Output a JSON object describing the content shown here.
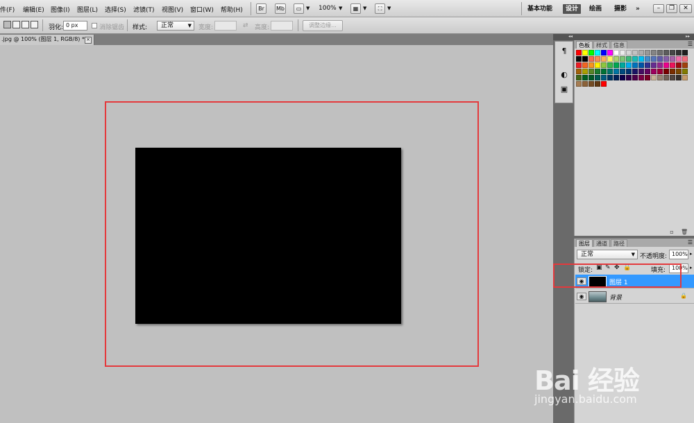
{
  "menu": [
    "件(F)",
    "编辑(E)",
    "图像(I)",
    "图层(L)",
    "选择(S)",
    "滤镜(T)",
    "视图(V)",
    "窗口(W)",
    "帮助(H)"
  ],
  "apptoolbar": {
    "br_label": "Br",
    "mb_label": "Mb",
    "zoom": "100%"
  },
  "workspaces": [
    "基本功能",
    "设计",
    "绘画",
    "摄影",
    "»"
  ],
  "window_buttons": {
    "minimize": "–",
    "restore": "❐",
    "close": "✕"
  },
  "options": {
    "feather_label": "羽化:",
    "feather_value": "0 px",
    "antialias_label": "消除锯齿",
    "style_label": "样式:",
    "style_value": "正常",
    "width_label": "宽度:",
    "height_label": "高度:",
    "refine_edge": "调整边缘..."
  },
  "document": {
    "tab_title": ".jpg @ 100% (图层 1, RGB/8) *",
    "canvas_color": "#000000"
  },
  "swatches_panel": {
    "tabs": [
      "色板",
      "样式",
      "信息"
    ],
    "colors": [
      "#ff0000",
      "#ffff00",
      "#00ff00",
      "#00ffff",
      "#0000ff",
      "#ff00ff",
      "#ffffff",
      "#ebebeb",
      "#d6d6d6",
      "#c2c2c2",
      "#adadad",
      "#999999",
      "#858585",
      "#707070",
      "#5c5c5c",
      "#474747",
      "#333333",
      "#1f1f1f",
      "#0a0a0a",
      "#000000",
      "#f26c4f",
      "#f68e55",
      "#fbaf5c",
      "#fff467",
      "#acd372",
      "#7cc576",
      "#3bb878",
      "#1abbb4",
      "#00bff3",
      "#438ccb",
      "#5574b9",
      "#605ca8",
      "#855fa8",
      "#a763a8",
      "#f06ea9",
      "#f26d7d",
      "#ed1c24",
      "#f26522",
      "#f7941d",
      "#fff200",
      "#8dc73f",
      "#39b54a",
      "#00a651",
      "#00a99d",
      "#00aeef",
      "#0072bc",
      "#0054a6",
      "#2e3192",
      "#662d91",
      "#92278f",
      "#ec008c",
      "#ed145b",
      "#9e0b0f",
      "#a0410d",
      "#a36209",
      "#aba000",
      "#598527",
      "#1a7b30",
      "#007236",
      "#00746b",
      "#0076a3",
      "#004b80",
      "#003471",
      "#1b1464",
      "#440e62",
      "#630460",
      "#9e005d",
      "#9e0039",
      "#790000",
      "#7b2e00",
      "#7d4900",
      "#827b00",
      "#406618",
      "#005e20",
      "#005826",
      "#005952",
      "#005b7f",
      "#003663",
      "#002157",
      "#0d004c",
      "#32004b",
      "#4b0049",
      "#7b0046",
      "#7a0026",
      "#c7b299",
      "#998675",
      "#736357",
      "#534741",
      "#37302d",
      "#c69c6d",
      "#a67c52",
      "#8c6239",
      "#754c24",
      "#603913",
      "#ff0000"
    ]
  },
  "layers_panel": {
    "tabs": [
      "图层",
      "通道",
      "路径"
    ],
    "blend_mode": "正常",
    "opacity_label": "不透明度:",
    "opacity_value": "100%",
    "lock_label": "锁定:",
    "fill_label": "填充:",
    "fill_value": "100%",
    "layers": [
      {
        "name": "图层 1",
        "selected": true
      },
      {
        "name": "背景",
        "selected": false
      }
    ]
  },
  "watermark": {
    "line1": "Bai 经验",
    "line2": "jingyan.baidu.com"
  },
  "colors": {
    "annotation_red": "#e4393c",
    "selected_layer": "#3399ff",
    "workspace_bg": "#c0c0c0"
  }
}
